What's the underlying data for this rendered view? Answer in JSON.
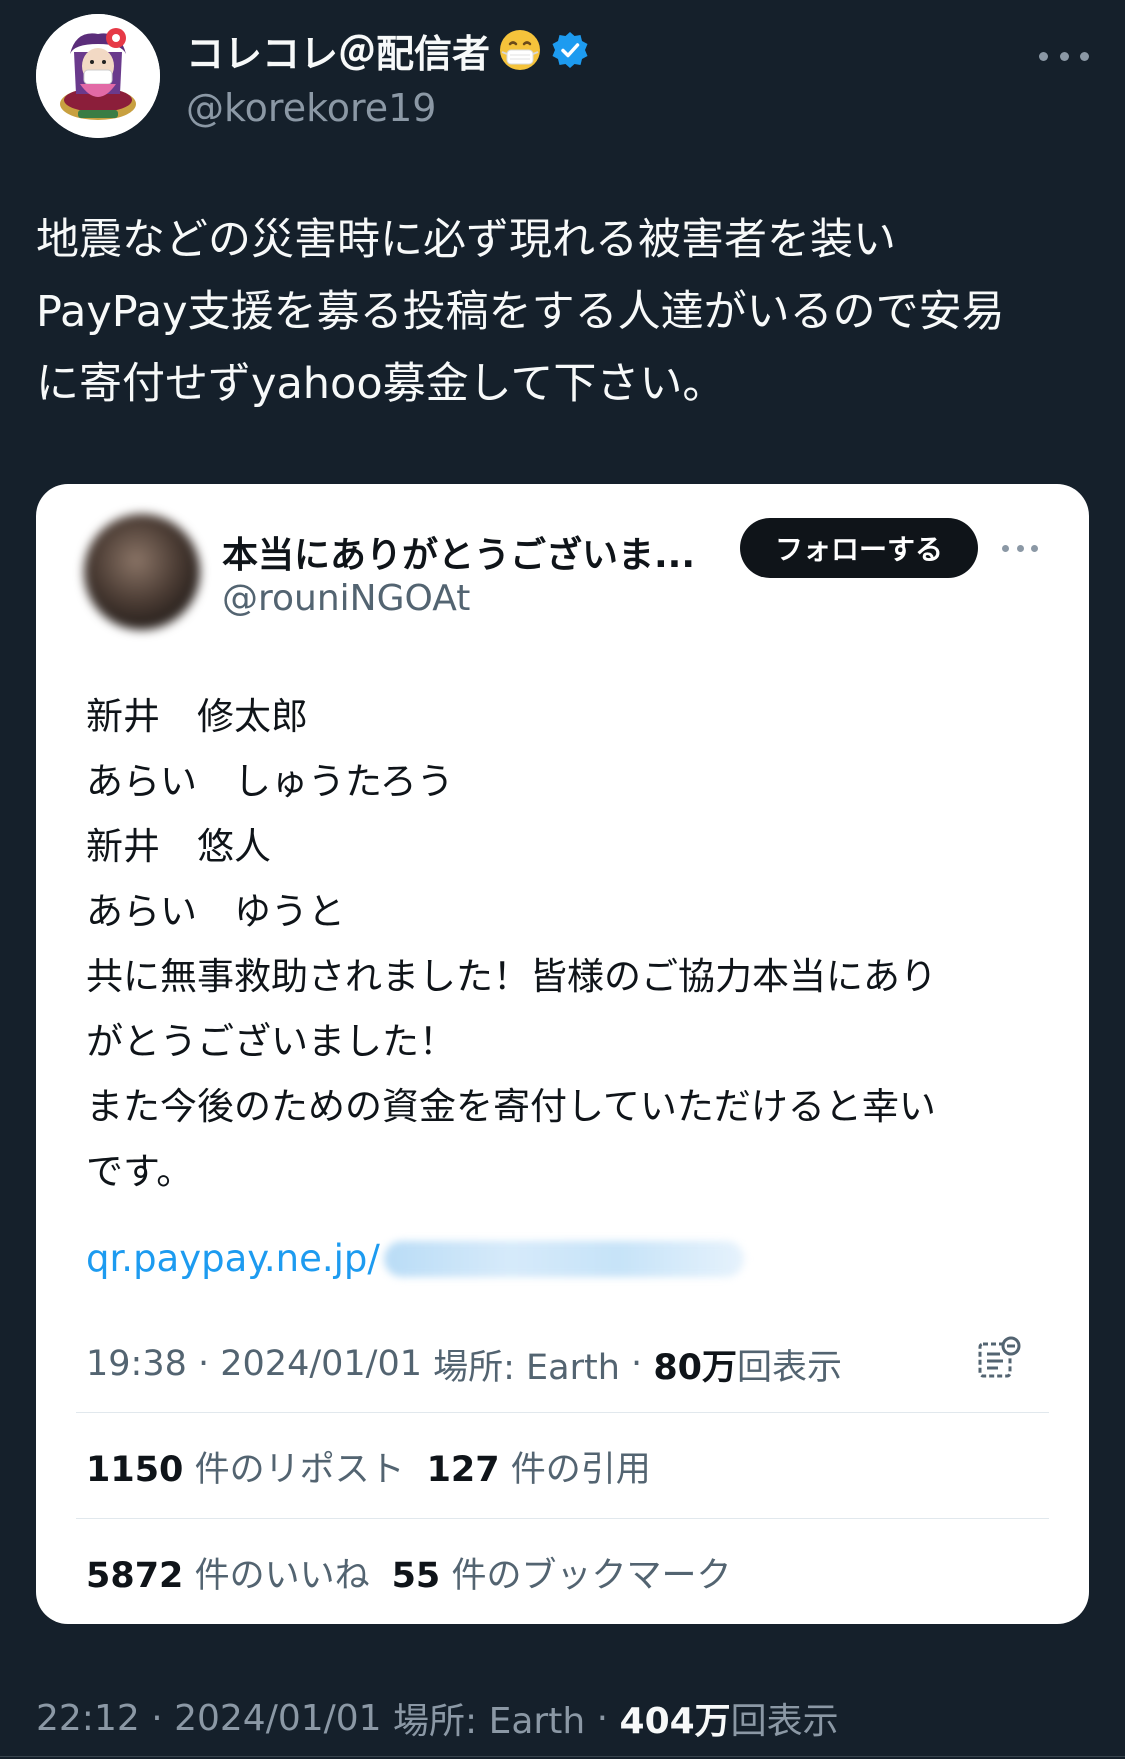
{
  "author": {
    "display_name": "コレコレ＠配信者",
    "handle": "@korekore19",
    "emoji": "mask-face-emoji",
    "verified_color": "#1d9bf0"
  },
  "tweet": {
    "lines": [
      "地震などの災害時に必ず現れる被害者を装い",
      "PayPay支援を募る投稿をする人達がいるので安易",
      "に寄付せずyahoo募金して下さい。"
    ],
    "time": "22:12",
    "date": "2024/01/01",
    "location": "場所: Earth",
    "views_count": "404万",
    "views_label": "回表示"
  },
  "quoted": {
    "display_name": "本当にありがとうございま...",
    "handle": "@rouniNGOAt",
    "follow_label": "フォローする",
    "body_lines": [
      "新井　修太郎",
      "あらい　しゅうたろう",
      "新井　悠人",
      "あらい　ゆうと",
      "共に無事救助されました！皆様のご協力本当にあり",
      "がとうございました！",
      "また今後のための資金を寄付していただけると幸い",
      "です。"
    ],
    "link_text": "qr.paypay.ne.jp/",
    "time": "19:38",
    "date": "2024/01/01",
    "location": "場所: Earth",
    "views_count": "80万",
    "views_label": "回表示",
    "stats": {
      "reposts_count": "1150",
      "reposts_label": "件のリポスト",
      "quotes_count": "127",
      "quotes_label": "件の引用",
      "likes_count": "5872",
      "likes_label": "件のいいね",
      "bookmarks_count": "55",
      "bookmarks_label": "件のブックマーク"
    }
  },
  "icons": {
    "more": "more-horizontal-icon",
    "verified": "verified-badge-icon",
    "analytics": "view-analytics-icon"
  }
}
